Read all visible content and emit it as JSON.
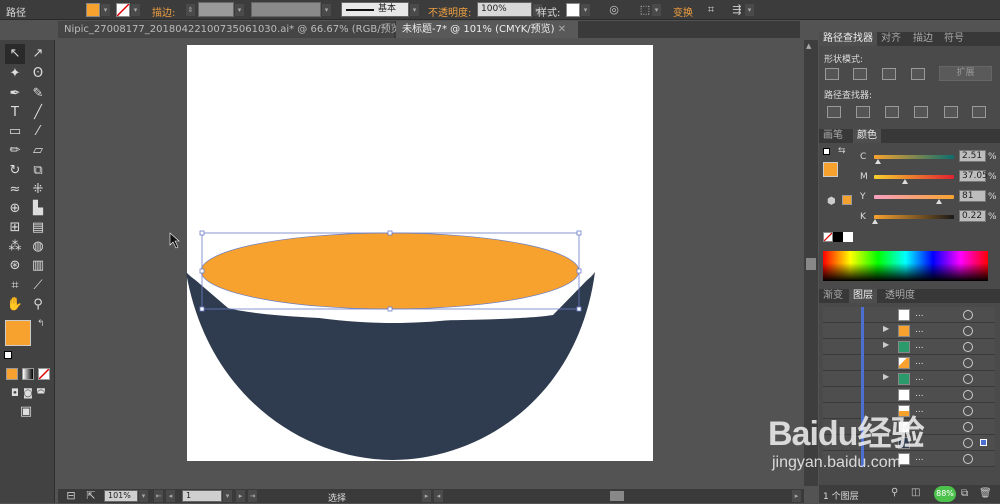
{
  "control_bar": {
    "object_type": "路径",
    "fill_color": "#f7a22e",
    "stroke_label": "描边:",
    "stroke_style_label": "基本",
    "opacity_label": "不透明度:",
    "opacity_value": "100%",
    "style_label": "样式:",
    "transform_label": "变换"
  },
  "tabs": [
    {
      "label": "Nipic_27008177_20180422100735061030.ai* @ 66.67% (RGB/预览)"
    },
    {
      "label": "未标题-7* @ 101% (CMYK/预览)"
    }
  ],
  "artwork": {
    "bowl_color": "#2f3b4e",
    "inner_color": "#f7a22e",
    "rim_color": "#ffffff"
  },
  "pathfinder_panel": {
    "tabs": [
      "路径查找器",
      "对齐",
      "描边",
      "符号"
    ],
    "shape_modes_label": "形状模式:",
    "expand_label": "扩展",
    "pathfinders_label": "路径查找器:"
  },
  "color_panel": {
    "tabs": [
      "画笔",
      "颜色"
    ],
    "channels": [
      {
        "name": "C",
        "value": "2.51",
        "unit": "%"
      },
      {
        "name": "M",
        "value": "37.05",
        "unit": "%"
      },
      {
        "name": "Y",
        "value": "81",
        "unit": "%"
      },
      {
        "name": "K",
        "value": "0.22",
        "unit": "%"
      }
    ]
  },
  "layers_panel": {
    "tabs": [
      "渐变",
      "图层",
      "透明度"
    ],
    "row_name": "...",
    "footer_label": "1 个图层"
  },
  "status_bar": {
    "zoom": "101%",
    "artboard_number": "1",
    "tool_status": "选择"
  },
  "watermark": {
    "brand": "Baidu经验",
    "url": "jingyan.baidu.com"
  },
  "system_badge": "88%"
}
